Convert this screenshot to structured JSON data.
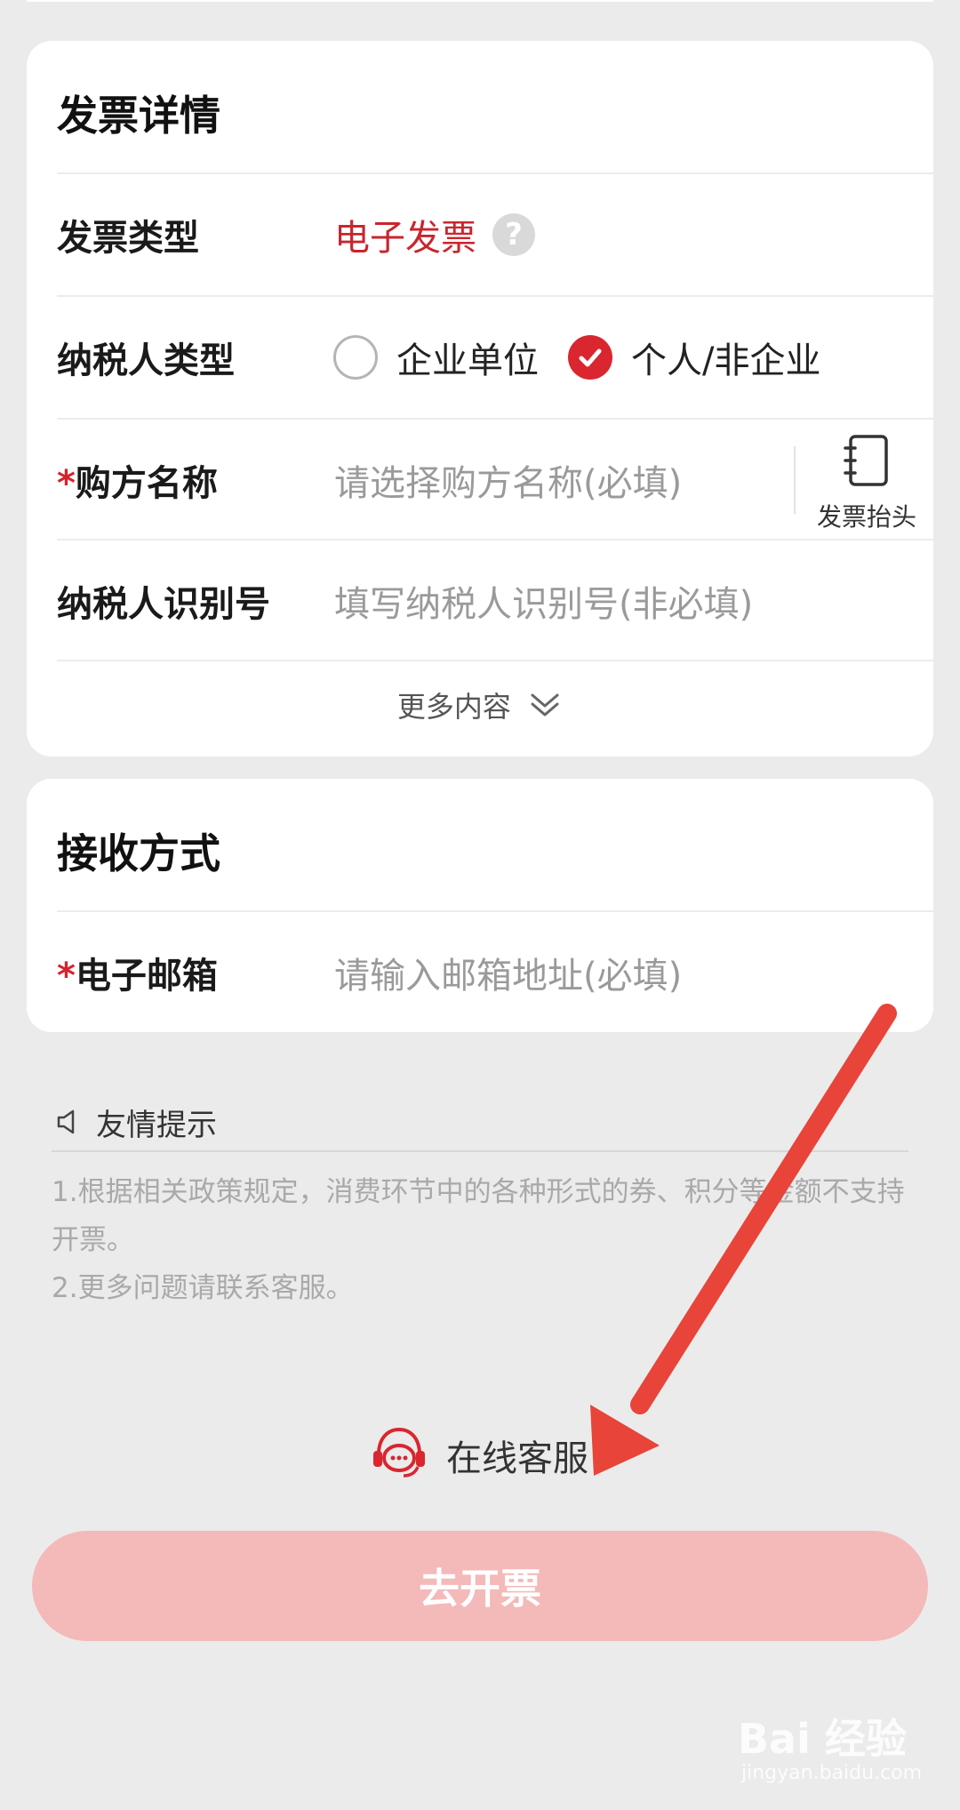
{
  "invoice_card": {
    "title": "发票详情",
    "type_label": "发票类型",
    "type_value": "电子发票",
    "help_icon": "question-circle-icon",
    "taxpayer_type_label": "纳税人类型",
    "option_enterprise": "企业单位",
    "option_personal": "个人/非企业",
    "selected_option": "个人/非企业",
    "required_mark": "*",
    "buyer_label": "购方名称",
    "buyer_placeholder": "请选择购方名称(必填)",
    "title_button_label": "发票抬头",
    "title_button_icon": "notebook-icon",
    "tax_id_label": "纳税人识别号",
    "tax_id_placeholder": "填写纳税人识别号(非必填)",
    "more_label": "更多内容",
    "more_icon": "chevron-down-icon"
  },
  "receive_card": {
    "title": "接收方式",
    "required_mark": "*",
    "email_label": "电子邮箱",
    "email_placeholder": "请输入邮箱地址(必填)"
  },
  "tips": {
    "icon": "speaker-icon",
    "title": "友情提示",
    "lines": [
      "1.根据相关政策规定，消费环节中的各种形式的券、积分等金额不支持开票。",
      "2.更多问题请联系客服。"
    ]
  },
  "service": {
    "icon": "headset-chat-icon",
    "label": "在线客服"
  },
  "submit_label": "去开票",
  "colors": {
    "accent": "#d9262f",
    "submit_disabled": "#f4b9b9",
    "arrow": "#e8443a"
  },
  "watermark": {
    "logo": "Bai  经验",
    "url": "jingyan.baidu.com"
  }
}
